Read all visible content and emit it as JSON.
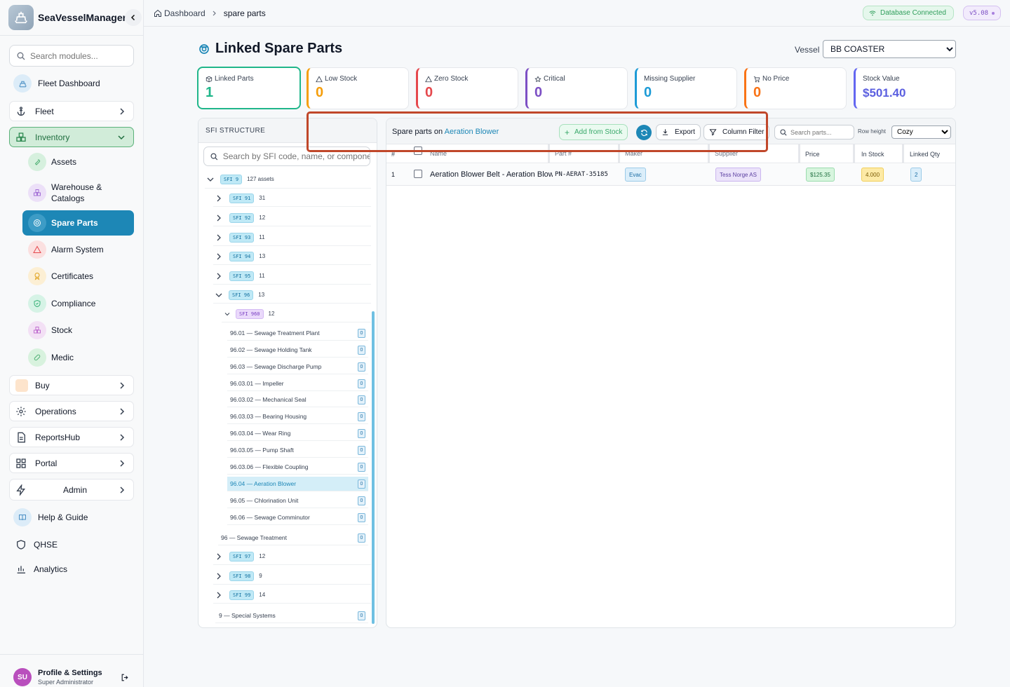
{
  "app": {
    "name": "SeaVesselManager"
  },
  "sidebar": {
    "search_placeholder": "Search modules...",
    "items": [
      {
        "label": "Fleet Dashboard",
        "icon": "ship-icon"
      },
      {
        "label": "Fleet",
        "icon": "anchor-icon"
      },
      {
        "label": "Inventory",
        "icon": "boxes-icon"
      },
      {
        "label": "Assets",
        "icon": "wrench-icon"
      },
      {
        "label": "Warehouse & Catalogs",
        "icon": "warehouse-icon"
      },
      {
        "label": "Spare Parts",
        "icon": "lifebuoy-icon"
      },
      {
        "label": "Alarm System",
        "icon": "alert-triangle-icon"
      },
      {
        "label": "Certificates",
        "icon": "award-icon"
      },
      {
        "label": "Compliance",
        "icon": "shield-check-icon"
      },
      {
        "label": "Stock",
        "icon": "boxes-icon"
      },
      {
        "label": "Medic",
        "icon": "pill-icon"
      },
      {
        "label": "Buy",
        "icon": "cart-icon"
      },
      {
        "label": "Operations",
        "icon": "gear-icon"
      },
      {
        "label": "ReportsHub",
        "icon": "report-icon"
      },
      {
        "label": "Portal",
        "icon": "grid-icon"
      },
      {
        "label": "Admin",
        "icon": "bolt-icon"
      },
      {
        "label": "Help & Guide",
        "icon": "book-icon"
      },
      {
        "label": "QHSE",
        "icon": "shield-icon"
      },
      {
        "label": "Analytics",
        "icon": "bar-chart-icon"
      }
    ],
    "profile": {
      "initials": "SU",
      "name": "Profile & Settings",
      "role": "Super Administrator"
    }
  },
  "topbar": {
    "breadcrumb": [
      "Dashboard",
      "spare parts"
    ],
    "db_status": "Database Connected",
    "version": "v5.08"
  },
  "page": {
    "title": "Linked Spare Parts",
    "vessel_label": "Vessel",
    "vessel_value": "BB COASTER"
  },
  "stats": [
    {
      "label": "Linked Parts",
      "value": "1",
      "color": "#20b68a",
      "icon": "box-icon"
    },
    {
      "label": "Low Stock",
      "value": "0",
      "color": "#f59e0b",
      "icon": "alert-triangle-icon"
    },
    {
      "label": "Zero Stock",
      "value": "0",
      "color": "#e5484d",
      "icon": "alert-triangle-icon"
    },
    {
      "label": "Critical",
      "value": "0",
      "color": "#7c4fc4",
      "icon": "star-icon"
    },
    {
      "label": "Missing Supplier",
      "value": "0",
      "color": "#1d9bd6",
      "icon": ""
    },
    {
      "label": "No Price",
      "value": "0",
      "color": "#f97316",
      "icon": "cart-icon"
    },
    {
      "label": "Stock Value",
      "value": "$501.40",
      "color": "#6366f1",
      "icon": ""
    }
  ],
  "sfi": {
    "header": "SFI STRUCTURE",
    "search_placeholder": "Search by SFI code, name, or component...",
    "root": {
      "tag": "SFI 9",
      "count": "127 assets"
    },
    "groups": [
      {
        "tag": "SFI 91",
        "count": "31"
      },
      {
        "tag": "SFI 92",
        "count": "12"
      },
      {
        "tag": "SFI 93",
        "count": "11"
      },
      {
        "tag": "SFI 94",
        "count": "13"
      },
      {
        "tag": "SFI 95",
        "count": "11"
      },
      {
        "tag": "SFI 96",
        "count": "13"
      }
    ],
    "sub": {
      "tag": "SFI 960",
      "count": "12"
    },
    "leaves": [
      {
        "label": "96.01 — Sewage Treatment Plant",
        "count": "0"
      },
      {
        "label": "96.02 — Sewage Holding Tank",
        "count": "0"
      },
      {
        "label": "96.03 — Sewage Discharge Pump",
        "count": "0"
      },
      {
        "label": "96.03.01 — Impeller",
        "count": "0"
      },
      {
        "label": "96.03.02 — Mechanical Seal",
        "count": "0"
      },
      {
        "label": "96.03.03 — Bearing Housing",
        "count": "0"
      },
      {
        "label": "96.03.04 — Wear Ring",
        "count": "0"
      },
      {
        "label": "96.03.05 — Pump Shaft",
        "count": "0"
      },
      {
        "label": "96.03.06 — Flexible Coupling",
        "count": "0"
      },
      {
        "label": "96.04 — Aeration Blower",
        "count": "0"
      },
      {
        "label": "96.05 — Chlorination Unit",
        "count": "0"
      },
      {
        "label": "96.06 — Sewage Comminutor",
        "count": "0"
      }
    ],
    "group96_leaf": {
      "label": "96 — Sewage Treatment",
      "count": "0"
    },
    "groups_after": [
      {
        "tag": "SFI 97",
        "count": "12"
      },
      {
        "tag": "SFI 98",
        "count": "9"
      },
      {
        "tag": "SFI 99",
        "count": "14"
      }
    ],
    "root_leaf": {
      "label": "9 — Special Systems",
      "count": "0"
    }
  },
  "table": {
    "title_prefix": "Spare parts on",
    "title_link": "Aeration Blower",
    "add_btn": "Add from Stock",
    "export_btn": "Export",
    "filter_btn": "Column Filter",
    "search_placeholder": "Search parts...",
    "row_height_label": "Row height",
    "row_height_value": "Cozy",
    "columns": [
      "#",
      "Name",
      "Part #",
      "Maker",
      "Supplier",
      "Price",
      "In Stock",
      "Linked Qty"
    ],
    "rows": [
      {
        "num": "1",
        "name": "Aeration Blower Belt - Aeration Blower",
        "part": "PN-AERAT-35185",
        "maker": "Evac",
        "supplier": "Tess Norge AS",
        "price": "$125.35",
        "stock": "4.000",
        "linked": "2"
      }
    ]
  }
}
